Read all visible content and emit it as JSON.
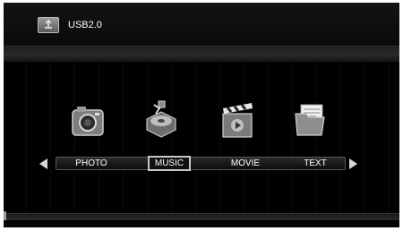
{
  "header": {
    "device_label": "USB2.0",
    "device_icon": "usb-drive-icon"
  },
  "media_menu": {
    "items": [
      {
        "label": "PHOTO",
        "icon": "camera-icon",
        "selected": false
      },
      {
        "label": "MUSIC",
        "icon": "music-player-icon",
        "selected": true
      },
      {
        "label": "MOVIE",
        "icon": "clapperboard-icon",
        "selected": false
      },
      {
        "label": "TEXT",
        "icon": "folder-documents-icon",
        "selected": false
      }
    ],
    "prev_icon": "arrow-left-icon",
    "next_icon": "arrow-right-icon"
  },
  "colors": {
    "background": "#000000",
    "text": "#ffffff",
    "highlight_border": "#c8c8c8"
  }
}
